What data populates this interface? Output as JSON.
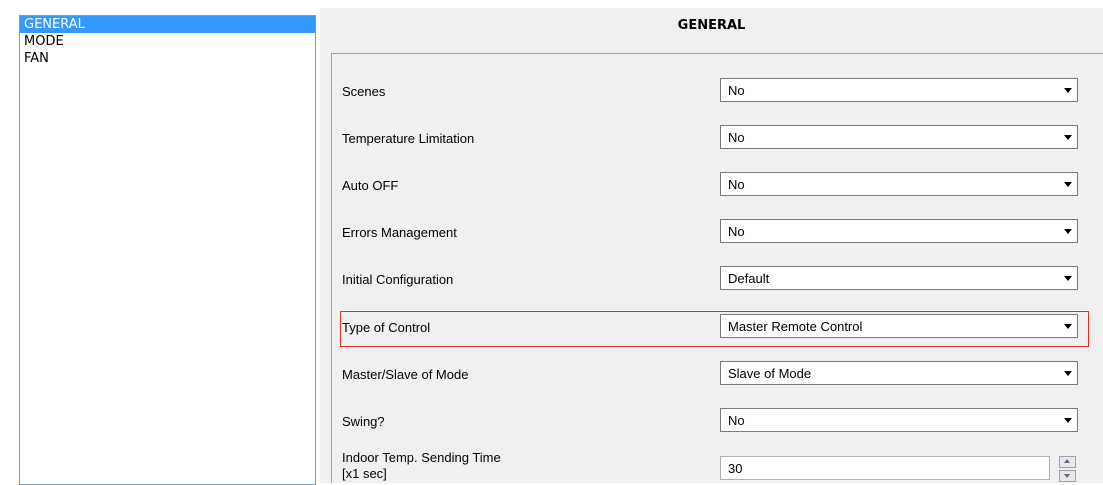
{
  "nav": {
    "items": [
      {
        "label": "GENERAL",
        "selected": true
      },
      {
        "label": "MODE",
        "selected": false
      },
      {
        "label": "FAN",
        "selected": false
      }
    ]
  },
  "panel": {
    "title": "GENERAL",
    "rows": [
      {
        "label": "Scenes",
        "value": "No"
      },
      {
        "label": "Temperature Limitation",
        "value": "No"
      },
      {
        "label": "Auto OFF",
        "value": "No"
      },
      {
        "label": "Errors Management",
        "value": "No"
      },
      {
        "label": "Initial Configuration",
        "value": "Default"
      },
      {
        "label": "Type of Control",
        "value": "Master Remote Control"
      },
      {
        "label": "Master/Slave of Mode",
        "value": "Slave of Mode"
      },
      {
        "label": "Swing?",
        "value": "No"
      }
    ],
    "sending_time": {
      "label_line1": "Indoor Temp. Sending Time",
      "label_line2": "[x1 sec]",
      "value": "30"
    }
  },
  "colors": {
    "selection": "#3399ff",
    "highlight_border": "#e03030",
    "panel_bg": "#f0f0f0"
  }
}
